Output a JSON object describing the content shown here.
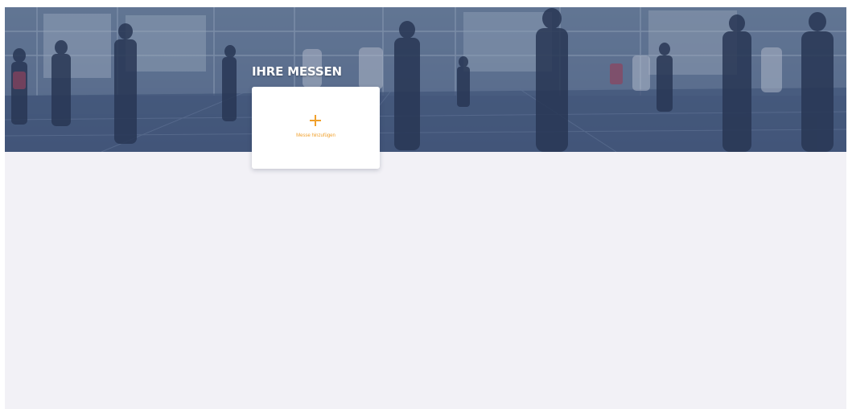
{
  "header": {
    "title": "IHRE MESSEN"
  },
  "add_card": {
    "label": "Messe hinzufügen",
    "icon": "plus-icon",
    "accent_color": "#f0a02c"
  },
  "colors": {
    "page_background": "#f2f1f6",
    "hero_overlay": "#3b4f73"
  }
}
